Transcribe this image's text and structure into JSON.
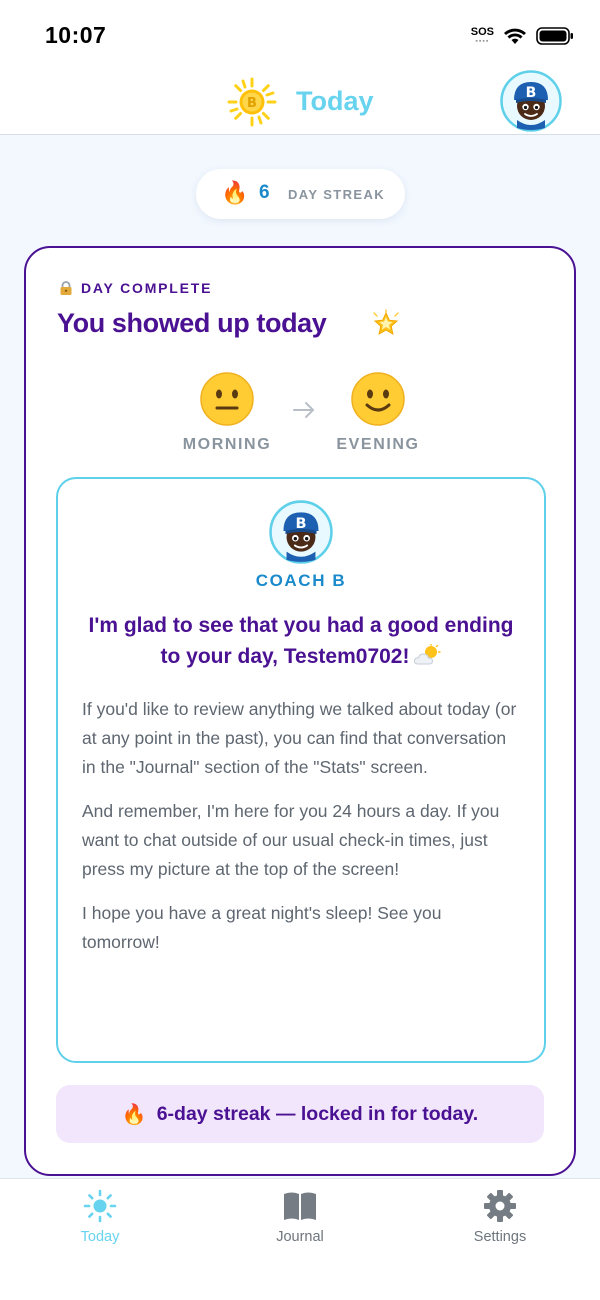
{
  "status_bar": {
    "time": "10:07",
    "sos": "SOS"
  },
  "header": {
    "title": "Today",
    "avatar_letter": "B"
  },
  "streak": {
    "fire": "🔥",
    "count": "6",
    "label": "DAY STREAK"
  },
  "day_card": {
    "status_label": "DAY COMPLETE",
    "title": "You showed up today",
    "mood": {
      "morning": {
        "label": "MORNING"
      },
      "evening": {
        "label": "EVENING"
      }
    }
  },
  "coach": {
    "avatar_letter": "B",
    "name": "COACH B",
    "headline": "I'm glad to see that you had a good ending to your day, Testem0702!",
    "paragraphs": [
      "If you'd like to review anything we talked about today (or at any point in the past), you can find that conversation in the \"Journal\" section of the \"Stats\" screen.",
      "And remember, I'm here for you 24 hours a day. If you want to chat outside of our usual check-in times, just press my picture at the top of the screen!",
      "I hope you have a great night's sleep! See you tomorrow!"
    ]
  },
  "locked_banner": {
    "fire": "🔥",
    "text": "6-day streak — locked in for today."
  },
  "tabs": [
    {
      "label": "Today",
      "icon": "sun-icon",
      "active": true
    },
    {
      "label": "Journal",
      "icon": "book-icon",
      "active": false
    },
    {
      "label": "Settings",
      "icon": "gear-icon",
      "active": false
    }
  ],
  "colors": {
    "brand_purple": "#4a1192",
    "accent_cyan": "#67d3ef",
    "link_blue": "#1a8acb"
  }
}
